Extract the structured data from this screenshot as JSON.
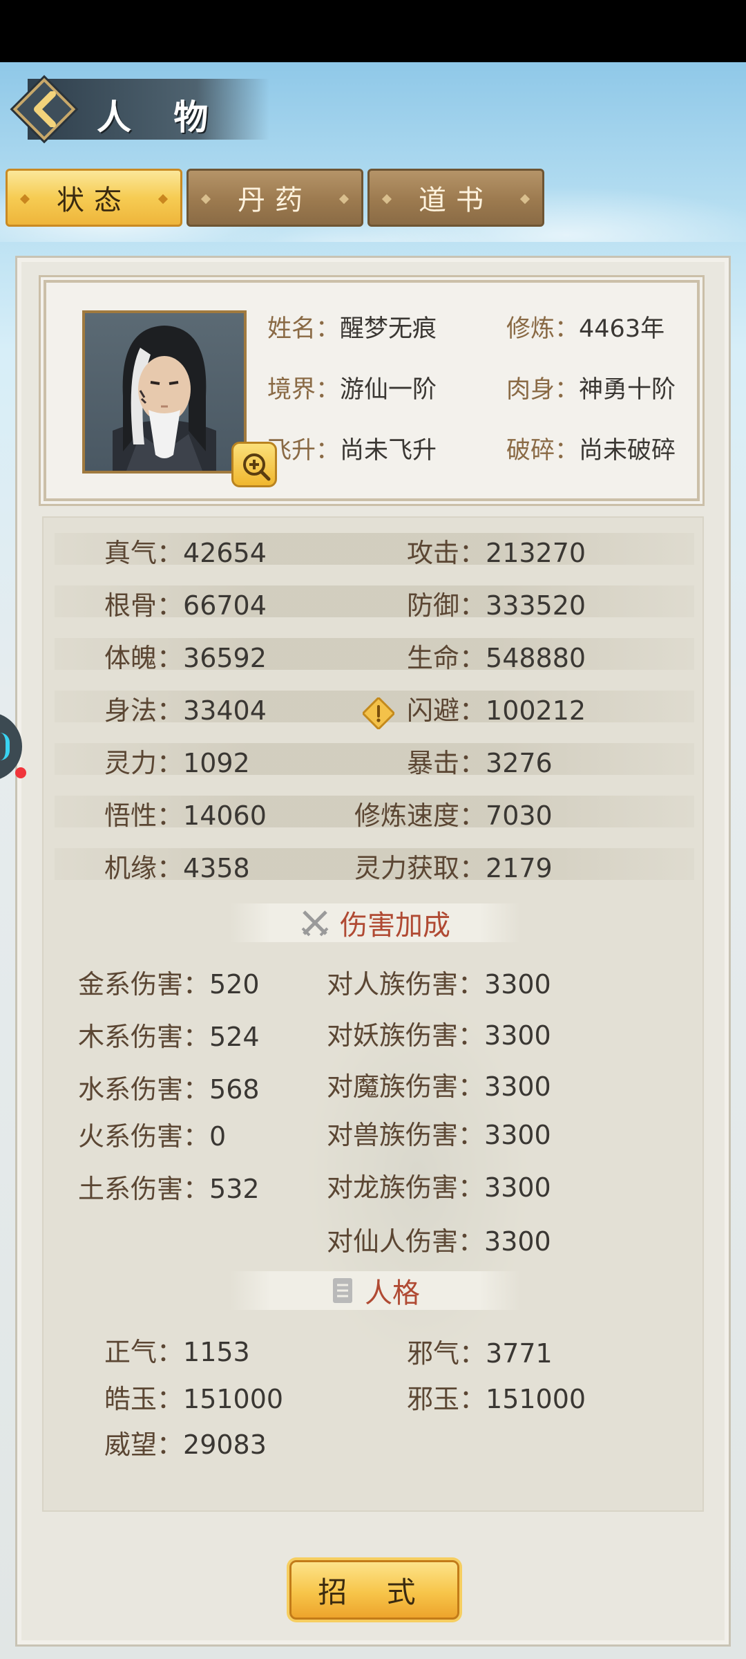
{
  "header": {
    "title": "人 物"
  },
  "tabs": [
    {
      "label": "状态",
      "active": true
    },
    {
      "label": "丹药",
      "active": false
    },
    {
      "label": "道书",
      "active": false
    }
  ],
  "profile": {
    "name_key": "姓名：",
    "name_val": "醒梦无痕",
    "cult_key": "修炼：",
    "cult_val": "4463年",
    "realm_key": "境界：",
    "realm_val": "游仙一阶",
    "body_key": "肉身：",
    "body_val": "神勇十阶",
    "ascend_key": "飞升：",
    "ascend_val": "尚未飞升",
    "shatter_key": "破碎：",
    "shatter_val": "尚未破碎"
  },
  "stats": [
    {
      "lk": "真气：",
      "lv": "42654",
      "rk": "攻击：",
      "rv": "213270"
    },
    {
      "lk": "根骨：",
      "lv": "66704",
      "rk": "防御：",
      "rv": "333520"
    },
    {
      "lk": "体魄：",
      "lv": "36592",
      "rk": "生命：",
      "rv": "548880"
    },
    {
      "lk": "身法：",
      "lv": "33404",
      "rk": "闪避：",
      "rv": "100212"
    },
    {
      "lk": "灵力：",
      "lv": "1092",
      "rk": "暴击：",
      "rv": "3276"
    },
    {
      "lk": "悟性：",
      "lv": "14060",
      "rk": "修炼速度：",
      "rv": "7030"
    },
    {
      "lk": "机缘：",
      "lv": "4358",
      "rk": "灵力获取：",
      "rv": "2179"
    }
  ],
  "damage": {
    "title": "伤害加成",
    "left": [
      {
        "k": "金系伤害：",
        "v": "520"
      },
      {
        "k": "木系伤害：",
        "v": "524"
      },
      {
        "k": "水系伤害：",
        "v": "568"
      },
      {
        "k": "火系伤害：",
        "v": "0"
      },
      {
        "k": "土系伤害：",
        "v": "532"
      }
    ],
    "right": [
      {
        "k": "对人族伤害：",
        "v": "3300"
      },
      {
        "k": "对妖族伤害：",
        "v": "3300"
      },
      {
        "k": "对魔族伤害：",
        "v": "3300"
      },
      {
        "k": "对兽族伤害：",
        "v": "3300"
      },
      {
        "k": "对龙族伤害：",
        "v": "3300"
      },
      {
        "k": "对仙人伤害：",
        "v": "3300"
      }
    ]
  },
  "personality": {
    "title": "人格",
    "items": [
      {
        "k": "正气：",
        "v": "1153"
      },
      {
        "k": "邪气：",
        "v": "3771"
      },
      {
        "k": "皓玉：",
        "v": "151000"
      },
      {
        "k": "邪玉：",
        "v": "151000"
      },
      {
        "k": "威望：",
        "v": "29083"
      }
    ]
  },
  "bottom": {
    "label": "招 式"
  },
  "icons": [
    "back-arrow-icon",
    "zoom-in-icon",
    "warning-icon",
    "crossed-swords-icon",
    "scroll-icon"
  ]
}
